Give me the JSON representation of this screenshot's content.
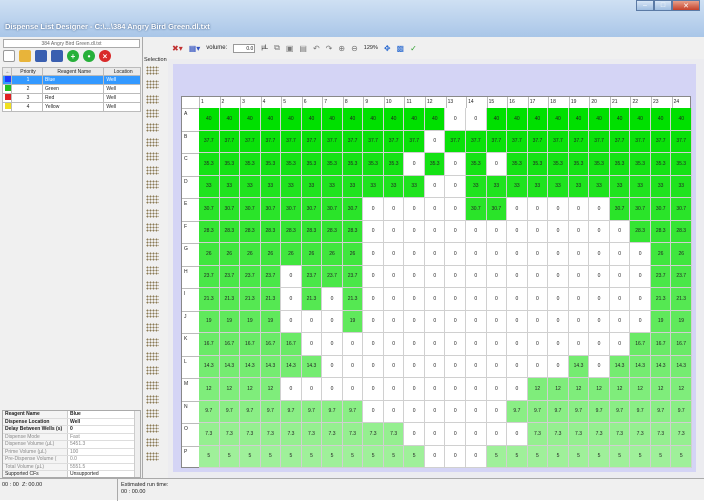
{
  "window": {
    "title": "Dispense List Designer - C:\\...\\384 Angry Bird Green.dl.txt"
  },
  "file_display": "384 Angry Bird Green.dl.txt",
  "reagent_table": {
    "headers": [
      "",
      "Priority",
      "Reagent Name",
      "Location"
    ],
    "rows": [
      {
        "priority": "1",
        "name": "Blue",
        "location": "Well",
        "selected": true,
        "color": "#1e3cff"
      },
      {
        "priority": "2",
        "name": "Green",
        "location": "Well",
        "selected": false,
        "color": "#22c020"
      },
      {
        "priority": "3",
        "name": "Red",
        "location": "Well",
        "selected": false,
        "color": "#e02020"
      },
      {
        "priority": "4",
        "name": "Yellow",
        "location": "Well",
        "selected": false,
        "color": "#f0e020"
      }
    ]
  },
  "properties": [
    {
      "key": "Reagent Name",
      "value": "Blue",
      "style": "b"
    },
    {
      "key": "Dispense Location",
      "value": "Well",
      "style": "b"
    },
    {
      "key": "Delay Between Wells (s)",
      "value": "0",
      "style": "b"
    },
    {
      "key": "Dispense Mode",
      "value": "Fast",
      "style": "g"
    },
    {
      "key": "Dispense Volume (µL)",
      "value": "5451.3",
      "style": "g"
    },
    {
      "key": "Prime Volume (µL)",
      "value": "100",
      "style": "g"
    },
    {
      "key": "Pre-Dispense Volume (",
      "value": "0.0",
      "style": "g"
    },
    {
      "key": "Total Volume (µL)",
      "value": "5551.5",
      "style": "g"
    },
    {
      "key": "Supported CFs",
      "value": "Unsupported",
      "style": ""
    }
  ],
  "selection_label": "Selection",
  "toolbar": {
    "volume_label": "volume:",
    "volume_value": "0.0",
    "volume_unit": "µL",
    "zoom": "129%"
  },
  "plate": {
    "columns": [
      "1",
      "2",
      "3",
      "4",
      "5",
      "6",
      "7",
      "8",
      "9",
      "10",
      "11",
      "12",
      "13",
      "14",
      "15",
      "16",
      "17",
      "18",
      "19",
      "20",
      "21",
      "22",
      "23",
      "24"
    ],
    "rows": [
      "A",
      "B",
      "C",
      "D",
      "E",
      "F",
      "G",
      "H",
      "I",
      "J",
      "K",
      "L",
      "M",
      "N",
      "O",
      "P"
    ],
    "values": [
      [
        "40",
        "40",
        "40",
        "40",
        "40",
        "40",
        "40",
        "40",
        "40",
        "40",
        "40",
        "40",
        "0",
        "0",
        "40",
        "40",
        "40",
        "40",
        "40",
        "40",
        "40",
        "40",
        "40",
        "40"
      ],
      [
        "37.7",
        "37.7",
        "37.7",
        "37.7",
        "37.7",
        "37.7",
        "37.7",
        "37.7",
        "37.7",
        "37.7",
        "37.7",
        "0",
        "37.7",
        "37.7",
        "37.7",
        "37.7",
        "37.7",
        "37.7",
        "37.7",
        "37.7",
        "37.7",
        "37.7",
        "37.7",
        "37.7"
      ],
      [
        "35.3",
        "35.3",
        "35.3",
        "35.3",
        "35.3",
        "35.3",
        "35.3",
        "35.3",
        "35.3",
        "35.3",
        "0",
        "35.3",
        "0",
        "35.3",
        "0",
        "35.3",
        "35.3",
        "35.3",
        "35.3",
        "35.3",
        "35.3",
        "35.3",
        "35.3",
        "35.3"
      ],
      [
        "33",
        "33",
        "33",
        "33",
        "33",
        "33",
        "33",
        "33",
        "33",
        "33",
        "33",
        "0",
        "0",
        "33",
        "33",
        "33",
        "33",
        "33",
        "33",
        "33",
        "33",
        "33",
        "33",
        "33"
      ],
      [
        "30.7",
        "30.7",
        "30.7",
        "30.7",
        "30.7",
        "30.7",
        "30.7",
        "30.7",
        "0",
        "0",
        "0",
        "0",
        "0",
        "30.7",
        "30.7",
        "0",
        "0",
        "0",
        "0",
        "0",
        "30.7",
        "30.7",
        "30.7",
        "30.7"
      ],
      [
        "28.3",
        "28.3",
        "28.3",
        "28.3",
        "28.3",
        "28.3",
        "28.3",
        "28.3",
        "0",
        "0",
        "0",
        "0",
        "0",
        "0",
        "0",
        "0",
        "0",
        "0",
        "0",
        "0",
        "0",
        "28.3",
        "28.3",
        "28.3"
      ],
      [
        "26",
        "26",
        "26",
        "26",
        "26",
        "26",
        "26",
        "26",
        "0",
        "0",
        "0",
        "0",
        "0",
        "0",
        "0",
        "0",
        "0",
        "0",
        "0",
        "0",
        "0",
        "0",
        "26",
        "26"
      ],
      [
        "23.7",
        "23.7",
        "23.7",
        "23.7",
        "0",
        "23.7",
        "23.7",
        "23.7",
        "0",
        "0",
        "0",
        "0",
        "0",
        "0",
        "0",
        "0",
        "0",
        "0",
        "0",
        "0",
        "0",
        "0",
        "23.7",
        "23.7"
      ],
      [
        "21.3",
        "21.3",
        "21.3",
        "21.3",
        "0",
        "21.3",
        "0",
        "21.3",
        "0",
        "0",
        "0",
        "0",
        "0",
        "0",
        "0",
        "0",
        "0",
        "0",
        "0",
        "0",
        "0",
        "0",
        "21.3",
        "21.3"
      ],
      [
        "19",
        "19",
        "19",
        "19",
        "0",
        "0",
        "0",
        "19",
        "0",
        "0",
        "0",
        "0",
        "0",
        "0",
        "0",
        "0",
        "0",
        "0",
        "0",
        "0",
        "0",
        "0",
        "19",
        "19"
      ],
      [
        "16.7",
        "16.7",
        "16.7",
        "16.7",
        "16.7",
        "0",
        "0",
        "0",
        "0",
        "0",
        "0",
        "0",
        "0",
        "0",
        "0",
        "0",
        "0",
        "0",
        "0",
        "0",
        "0",
        "16.7",
        "16.7",
        "16.7"
      ],
      [
        "14.3",
        "14.3",
        "14.3",
        "14.3",
        "14.3",
        "14.3",
        "0",
        "0",
        "0",
        "0",
        "0",
        "0",
        "0",
        "0",
        "0",
        "0",
        "0",
        "0",
        "14.3",
        "0",
        "14.3",
        "14.3",
        "14.3",
        "14.3"
      ],
      [
        "12",
        "12",
        "12",
        "12",
        "0",
        "0",
        "0",
        "0",
        "0",
        "0",
        "0",
        "0",
        "0",
        "0",
        "0",
        "0",
        "12",
        "12",
        "12",
        "12",
        "12",
        "12",
        "12",
        "12"
      ],
      [
        "9.7",
        "9.7",
        "9.7",
        "9.7",
        "9.7",
        "9.7",
        "9.7",
        "9.7",
        "0",
        "0",
        "0",
        "0",
        "0",
        "0",
        "0",
        "9.7",
        "9.7",
        "9.7",
        "9.7",
        "9.7",
        "9.7",
        "9.7",
        "9.7",
        "9.7"
      ],
      [
        "7.3",
        "7.3",
        "7.3",
        "7.3",
        "7.3",
        "7.3",
        "7.3",
        "7.3",
        "7.3",
        "7.3",
        "0",
        "0",
        "0",
        "0",
        "0",
        "0",
        "7.3",
        "7.3",
        "7.3",
        "7.3",
        "7.3",
        "7.3",
        "7.3",
        "7.3"
      ],
      [
        "5",
        "5",
        "5",
        "5",
        "5",
        "5",
        "5",
        "5",
        "5",
        "5",
        "5",
        "0",
        "0",
        "0",
        "5",
        "5",
        "5",
        "5",
        "5",
        "5",
        "5",
        "5",
        "5",
        "5"
      ]
    ],
    "max_value": 40,
    "fill_color_high": "#00e000",
    "fill_color_low": "#b6f2b0"
  },
  "status": {
    "pos1": "00 : 00",
    "pos2": "Z: 00.00",
    "est_label": "Estimated run time:",
    "est_value": "00 : 00.00"
  }
}
